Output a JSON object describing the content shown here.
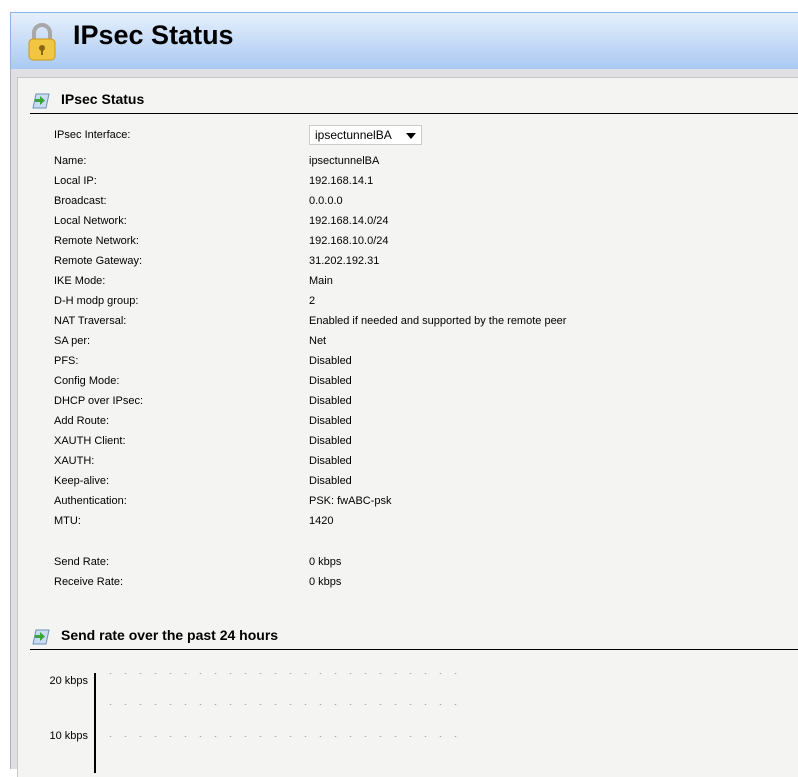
{
  "header": {
    "title": "IPsec Status",
    "icon": "lock-icon"
  },
  "status_section": {
    "title": "IPsec Status",
    "interface_label": "IPsec Interface:",
    "interface_value": "ipsectunnelBA",
    "rows": [
      {
        "label": "Name:",
        "value": "ipsectunnelBA"
      },
      {
        "label": "Local IP:",
        "value": "192.168.14.1"
      },
      {
        "label": "Broadcast:",
        "value": "0.0.0.0"
      },
      {
        "label": "Local Network:",
        "value": "192.168.14.0/24"
      },
      {
        "label": "Remote Network:",
        "value": "192.168.10.0/24"
      },
      {
        "label": "Remote Gateway:",
        "value": "31.202.192.31"
      },
      {
        "label": "IKE Mode:",
        "value": "Main"
      },
      {
        "label": "D-H modp group:",
        "value": "2"
      },
      {
        "label": "NAT Traversal:",
        "value": "Enabled if needed and supported by the remote peer"
      },
      {
        "label": "SA per:",
        "value": "Net"
      },
      {
        "label": "PFS:",
        "value": "Disabled"
      },
      {
        "label": "Config Mode:",
        "value": "Disabled"
      },
      {
        "label": "DHCP over IPsec:",
        "value": "Disabled"
      },
      {
        "label": "Add Route:",
        "value": "Disabled"
      },
      {
        "label": "XAUTH Client:",
        "value": "Disabled"
      },
      {
        "label": "XAUTH:",
        "value": "Disabled"
      },
      {
        "label": "Keep-alive:",
        "value": "Disabled"
      },
      {
        "label": "Authentication:",
        "value": "PSK: fwABC-psk"
      },
      {
        "label": "MTU:",
        "value": "1420"
      }
    ],
    "rate_rows": [
      {
        "label": "Send Rate:",
        "value": "0 kbps"
      },
      {
        "label": "Receive Rate:",
        "value": "0 kbps"
      }
    ]
  },
  "chart_section": {
    "title": "Send rate over the past 24 hours"
  },
  "chart_data": {
    "type": "line",
    "title": "Send rate over the past 24 hours",
    "ylabel": "",
    "y_ticks": [
      "20 kbps",
      "10 kbps"
    ],
    "series": [],
    "grid": true
  }
}
